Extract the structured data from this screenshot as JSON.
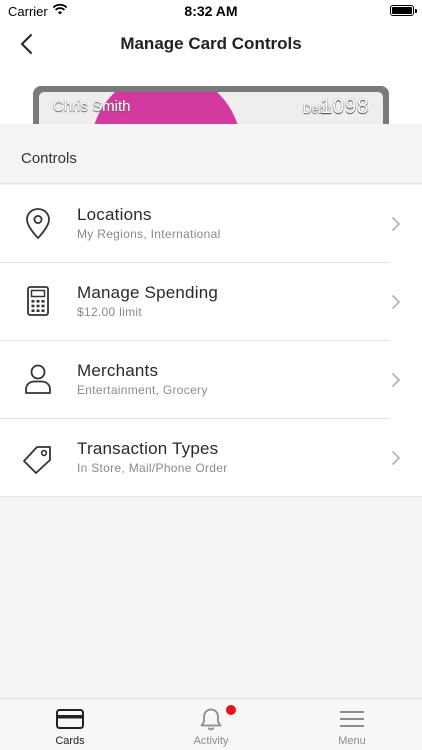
{
  "status_bar": {
    "carrier": "Carrier",
    "time": "8:32 AM"
  },
  "nav": {
    "title": "Manage Card Controls",
    "back_icon": "chevron-left-icon"
  },
  "card": {
    "holder_name": "Chris Smith",
    "type": "Debit",
    "last_four": "1098",
    "accent_color": "#d33aa0"
  },
  "section": {
    "title": "Controls"
  },
  "controls": [
    {
      "icon": "location-pin-icon",
      "label": "Locations",
      "sub": "My Regions, International"
    },
    {
      "icon": "calculator-icon",
      "label": "Manage Spending",
      "sub": "$12.00 limit"
    },
    {
      "icon": "person-icon",
      "label": "Merchants",
      "sub": "Entertainment, Grocery"
    },
    {
      "icon": "tag-icon",
      "label": "Transaction Types",
      "sub": "In Store, Mail/Phone Order"
    }
  ],
  "tabs": [
    {
      "icon": "card-icon",
      "label": "Cards",
      "active": true
    },
    {
      "icon": "bell-icon",
      "label": "Activity",
      "badge": true,
      "badge_color": "#e8101c"
    },
    {
      "icon": "menu-icon",
      "label": "Menu"
    }
  ]
}
